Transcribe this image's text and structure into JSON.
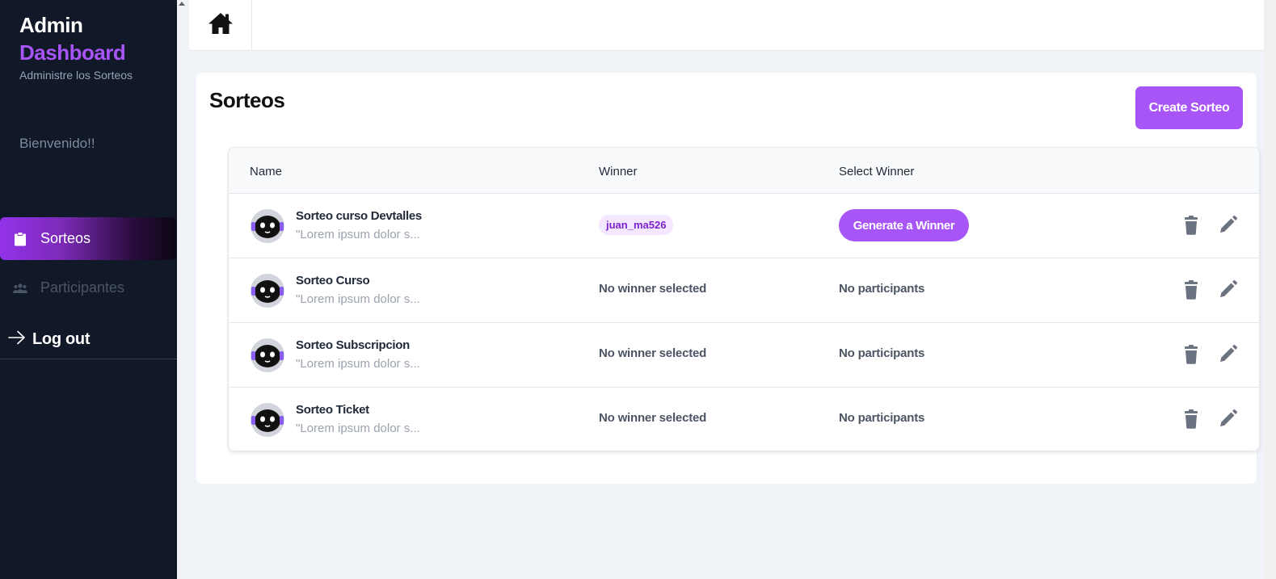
{
  "sidebar": {
    "brand_line1": "Admin",
    "brand_line2": "Dashboard",
    "subtitle": "Administre los Sorteos",
    "welcome": "Bienvenido!!",
    "nav": [
      {
        "label": "Sorteos",
        "icon": "clipboard-icon",
        "active": true
      },
      {
        "label": "Participantes",
        "icon": "users-icon",
        "active": false
      }
    ],
    "logout_label": "Log out"
  },
  "topbar": {
    "home_icon": "home-icon"
  },
  "main": {
    "title": "Sorteos",
    "create_label": "Create Sorteo",
    "table": {
      "headers": [
        "Name",
        "Winner",
        "Select Winner"
      ],
      "rows": [
        {
          "name": "Sorteo curso Devtalles",
          "desc": "\"Lorem ipsum dolor s...",
          "winner": "juan_ma526",
          "select": "Generate a Winner"
        },
        {
          "name": "Sorteo Curso",
          "desc": "\"Lorem ipsum dolor s...",
          "winner": "No winner selected",
          "select": "No participants"
        },
        {
          "name": "Sorteo Subscripcion",
          "desc": "\"Lorem ipsum dolor s...",
          "winner": "No winner selected",
          "select": "No participants"
        },
        {
          "name": "Sorteo Ticket",
          "desc": "\"Lorem ipsum dolor s...",
          "winner": "No winner selected",
          "select": "No participants"
        }
      ]
    }
  },
  "colors": {
    "accent": "#a855f7",
    "sidebar_bg": "#111827",
    "page_bg": "#f0f3f8"
  }
}
